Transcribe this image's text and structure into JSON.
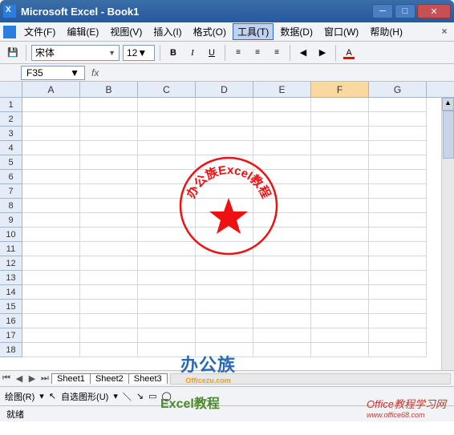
{
  "window": {
    "title": "Microsoft Excel - Book1"
  },
  "menu": {
    "file": "文件(F)",
    "edit": "编辑(E)",
    "view": "视图(V)",
    "insert": "插入(I)",
    "format": "格式(O)",
    "tools": "工具(T)",
    "data": "数据(D)",
    "window": "窗口(W)",
    "help": "帮助(H)"
  },
  "toolbar": {
    "font_name": "宋体",
    "font_size": "12",
    "bold": "B",
    "italic": "I",
    "underline": "U",
    "font_color_glyph": "A"
  },
  "namebox": {
    "value": "F35",
    "fx": "fx"
  },
  "columns": [
    "A",
    "B",
    "C",
    "D",
    "E",
    "F",
    "G"
  ],
  "rows": [
    1,
    2,
    3,
    4,
    5,
    6,
    7,
    8,
    9,
    10,
    11,
    12,
    13,
    14,
    15,
    16,
    17,
    18
  ],
  "selected_column_index": 5,
  "tabs": {
    "s1": "Sheet1",
    "s2": "Sheet2",
    "s3": "Sheet3"
  },
  "drawbar": {
    "label": "绘图(R)",
    "autoshape": "自选图形(U)"
  },
  "status": {
    "ready": "就绪"
  },
  "stamp": {
    "text": "办公族Excel教程"
  },
  "watermarks": {
    "w1": "办公族",
    "w1sub": "Officezu.com",
    "w2": "Excel教程",
    "w3": "Office教程学习网",
    "w3sub": "www.office68.com"
  }
}
